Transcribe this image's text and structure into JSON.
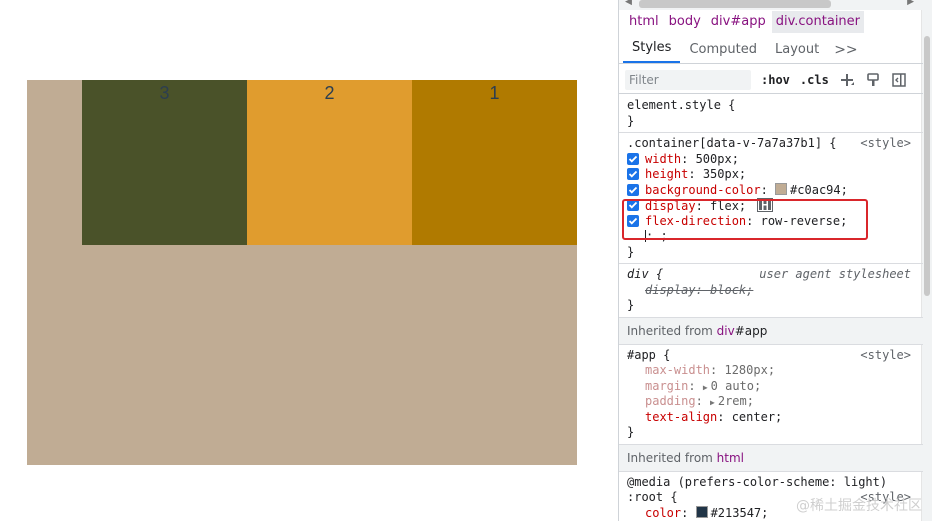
{
  "page": {
    "boxes": [
      {
        "label": "1",
        "color": "#b07a00"
      },
      {
        "label": "2",
        "color": "#e09c2e"
      },
      {
        "label": "3",
        "color": "#4a5229"
      }
    ],
    "container_color": "#c0ac94"
  },
  "devtools": {
    "breadcrumbs": [
      {
        "tag": "html",
        "id": ""
      },
      {
        "tag": "body",
        "id": ""
      },
      {
        "tag": "div",
        "id": "#app"
      },
      {
        "tag": "div",
        "id": ".container"
      }
    ],
    "tabs": {
      "styles": "Styles",
      "computed": "Computed",
      "layout": "Layout",
      "more": ">>"
    },
    "filter": {
      "placeholder": "Filter",
      "hov": ":hov",
      "cls": ".cls"
    },
    "element_style": {
      "selector": "element.style {",
      "close": "}"
    },
    "container_rule": {
      "selector": ".container[data-v-7a7a37b1] {",
      "source": "<style>",
      "decls": [
        {
          "prop": "width",
          "value": "500px;"
        },
        {
          "prop": "height",
          "value": "350px;"
        },
        {
          "prop": "background-color",
          "value": "#c0ac94;"
        },
        {
          "prop": "display",
          "value": "flex;"
        },
        {
          "prop": "flex-direction",
          "value": "row-reverse;"
        }
      ],
      "empty_decl": ": ;",
      "close": "}"
    },
    "ua_rule": {
      "selector": "div {",
      "source": "user agent stylesheet",
      "decl": "display: block;",
      "close": "}"
    },
    "inherited_app": {
      "prefix": "Inherited from ",
      "tag": "div",
      "id": "#app"
    },
    "app_rule": {
      "selector": "#app {",
      "source": "<style>",
      "decls": [
        {
          "prop": "max-width",
          "value": "1280px;"
        },
        {
          "prop": "margin",
          "value": "0 auto;"
        },
        {
          "prop": "padding",
          "value": "2rem;"
        },
        {
          "prop": "text-align",
          "value": "center;"
        }
      ],
      "close": "}"
    },
    "inherited_html": {
      "prefix": "Inherited from ",
      "tag": "html"
    },
    "root_rule": {
      "media": "@media (prefers-color-scheme: light)",
      "selector": ":root {",
      "source": "<style>",
      "decl_prop": "color",
      "decl_value": "#213547;"
    }
  },
  "watermark": "@稀土掘金技术社区"
}
